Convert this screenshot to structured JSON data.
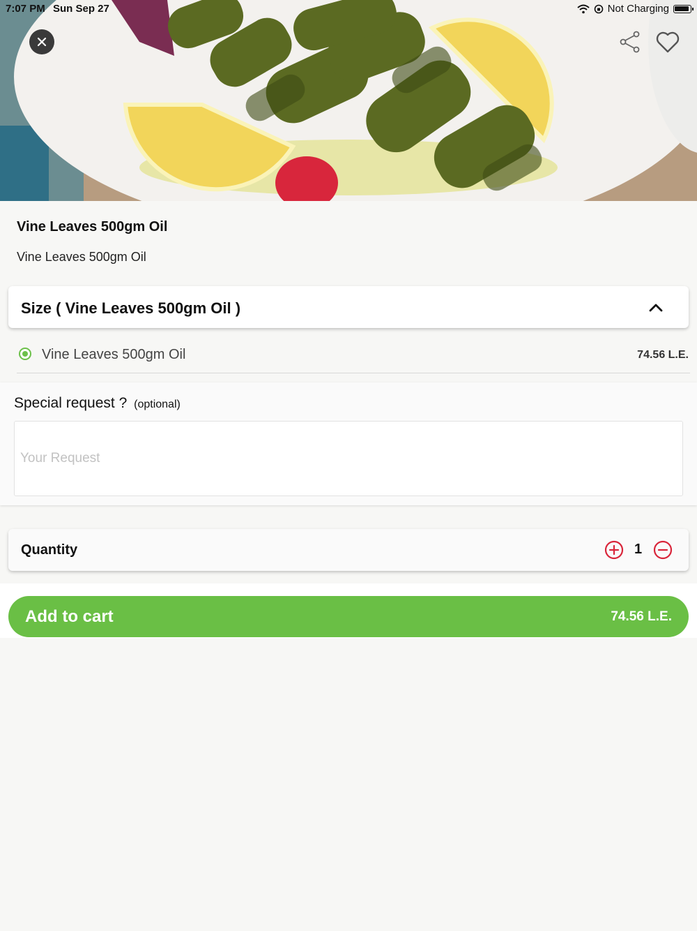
{
  "status_bar": {
    "time": "7:07 PM",
    "date": "Sun Sep 27",
    "charging": "Not Charging"
  },
  "product": {
    "title": "Vine Leaves 500gm Oil",
    "description": "Vine Leaves 500gm Oil"
  },
  "size_section": {
    "title": "Size ( Vine Leaves 500gm Oil )",
    "options": [
      {
        "label": "Vine Leaves 500gm Oil",
        "price": "74.56 L.E.",
        "selected": true
      }
    ]
  },
  "special_request": {
    "label": "Special request ?",
    "optional": "(optional)",
    "placeholder": "Your Request",
    "value": ""
  },
  "quantity": {
    "label": "Quantity",
    "value": "1"
  },
  "cart": {
    "label": "Add to cart",
    "price": "74.56 L.E."
  },
  "colors": {
    "accent_green": "#6abf45",
    "stepper_red": "#d9253a"
  },
  "icons": [
    "close-icon",
    "share-icon",
    "heart-icon",
    "chevron-up-icon",
    "plus-circle-icon",
    "minus-circle-icon",
    "wifi-icon",
    "battery-icon"
  ]
}
